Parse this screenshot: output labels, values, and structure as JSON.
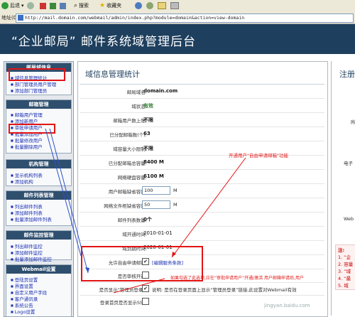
{
  "browser": {
    "back_label": "后退",
    "search_label": "搜索",
    "favorites_label": "收藏夹",
    "address_label": "地址(D)",
    "url": "http://mail.domain.com/webmail/admin/index.php?module=domain&action=view-domain"
  },
  "banner": {
    "title": "“企业邮局” 邮件系统域管理后台"
  },
  "sidebar": {
    "groups": [
      {
        "title": "邮局域信息",
        "items": [
          "域信息管理统计",
          "部门管理员用户管理",
          "添加部门管理员"
        ]
      },
      {
        "title": "邮箱管理",
        "items": [
          "邮箱用户管理",
          "添加新用户",
          "审批申请用户",
          "批量添加用户",
          "批量修改用户",
          "批量删除用户"
        ]
      },
      {
        "title": "机构管理",
        "items": [
          "显示机构列表",
          "添加机构"
        ]
      },
      {
        "title": "邮件列表管理",
        "items": [
          "列出邮件列表",
          "添加邮件列表",
          "批量添加邮件列表"
        ]
      },
      {
        "title": "邮件监控管理",
        "items": [
          "列出邮件监控",
          "添加邮件监控",
          "批量添加邮件监控"
        ]
      },
      {
        "title": "Webmail设置",
        "items": [
          "登陆页设置",
          "界面设置",
          "自定义用户字段",
          "客户通讯录",
          "系统公告",
          "Logo设置"
        ]
      }
    ]
  },
  "main": {
    "title": "域信息管理统计",
    "rows": [
      {
        "label": "邮局域名:",
        "value": "domain.com"
      },
      {
        "label": "域状态:",
        "value": "有效"
      },
      {
        "label": "邮箱用户数上限:",
        "value": "不限"
      },
      {
        "label": "已分配邮箱数(个):",
        "value": "63"
      },
      {
        "label": "域容量大小限制:",
        "value": "不限"
      },
      {
        "label": "已分配邮箱总容量:",
        "value": "8400 M"
      },
      {
        "label": "网络硬盘容量:",
        "value": "6100 M"
      },
      {
        "label": "用户邮箱缺省容量:",
        "input": "100",
        "unit": "M"
      },
      {
        "label": "网络文件柜缺省容量:",
        "input": "50",
        "unit": "M"
      },
      {
        "label": "邮件列表数量:",
        "value": "0个"
      },
      {
        "label": "域开通时间:",
        "value": "2010-01-01"
      },
      {
        "label": "域到期时间:",
        "value": "2020-01-01"
      },
      {
        "label": "允许自由申请邮箱:",
        "checked": "✔",
        "note": "[编辑服务条款]"
      },
      {
        "label": "是否审核开通:",
        "checked": ""
      }
    ],
    "login_show_label": "是否显示“管理员登录”:",
    "login_show_note": "说明: 是否在登录页面上显示“管理员登录”链接,此设置对Webmail有效",
    "ssl_label": "登录首页是否显示SSL:"
  },
  "right_panel": {
    "title": "注册",
    "label_1": "所",
    "label_2": "电子",
    "label_3": "Web",
    "note_head": "注:",
    "notes": [
      "1. “企",
      "2. 容量",
      "3. “域",
      "4. “最",
      "5. 域"
    ]
  },
  "annotations": {
    "top_callout": "开通用户\"自由申请邮箱\"功能",
    "bottom_callout": "如果勾选了此选项,应在“审批申请用户”开通/激活 用户邮箱申请后,用户",
    "watermark": "jingyan.baidu.com"
  }
}
